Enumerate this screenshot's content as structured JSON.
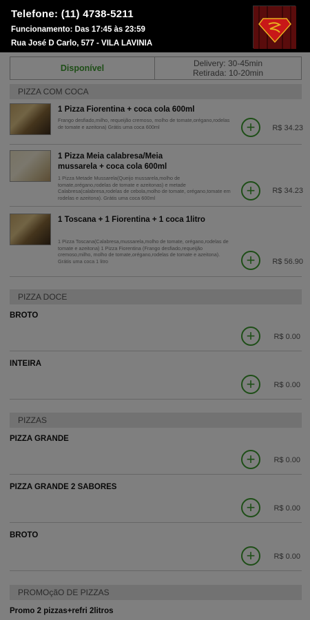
{
  "header": {
    "phone": "Telefone: (11) 4738-5211",
    "hours": "Funcionamento: Das 17:45 às 23:59",
    "address": "Rua José D Carlo, 577 - VILA LAVINIA",
    "logo_icon": "superman-shield-logo"
  },
  "status": {
    "availability": "Disponível",
    "delivery": "Delivery: 30-45min",
    "pickup": "Retirada: 10-20min"
  },
  "sections": [
    {
      "label": "PIZZA COM COCA"
    },
    {
      "label": "PIZZA DOCE"
    },
    {
      "label": "PIZZAS"
    },
    {
      "label": "PROMOçãO DE PIZZAS"
    }
  ],
  "items": [
    {
      "title": "1 Pizza Fiorentina + coca cola 600ml",
      "description": "Frango desfiado,milho, requeijão cremoso, molho de tomate,orégano,rodelas de tomate e azeitona) Grátis uma coca 600ml",
      "price": "R$ 34.23"
    },
    {
      "title": "1 Pizza Meia calabresa/Meia mussarela + coca cola 600ml",
      "description": "1 Pizza Metade Mussarela(Queijo mussarela,molho de tomate,orégano,rodelas de tomate e azeitonas) e metade Calabresa(calabresa,rodelas de cebola,molho de tomate, orégano,tomate em rodelas e azeitona). Grátis uma coca 600ml",
      "price": "R$ 34.23"
    },
    {
      "title": "1 Toscana + 1 Fiorentina + 1 coca 1litro",
      "description": "1 Pizza Toscana(Calabresa,mussarela,molho de tomate, orégano,rodelas de tomate e azeitona) 1 Pizza Fiorentina (Frango desfiado,requeijão cremoso,milho, molho de tomate,orégano,rodelas de tomate e azeitona). Grátis uma coca 1 litro",
      "price": "R$ 56.90"
    },
    {
      "title": "BROTO",
      "price": "R$ 0.00"
    },
    {
      "title": "INTEIRA",
      "price": "R$ 0.00"
    },
    {
      "title": "PIZZA GRANDE",
      "price": "R$ 0.00"
    },
    {
      "title": "PIZZA GRANDE 2 SABORES",
      "price": "R$ 0.00"
    },
    {
      "title": "BROTO",
      "price": "R$ 0.00"
    },
    {
      "title": "Promo 2 pizzas+refri 2litros"
    }
  ],
  "add_button_symbol": "+",
  "colors": {
    "accent_green": "#3d9c2e",
    "header_bg": "#000000",
    "section_bg": "#e4e4e4"
  }
}
